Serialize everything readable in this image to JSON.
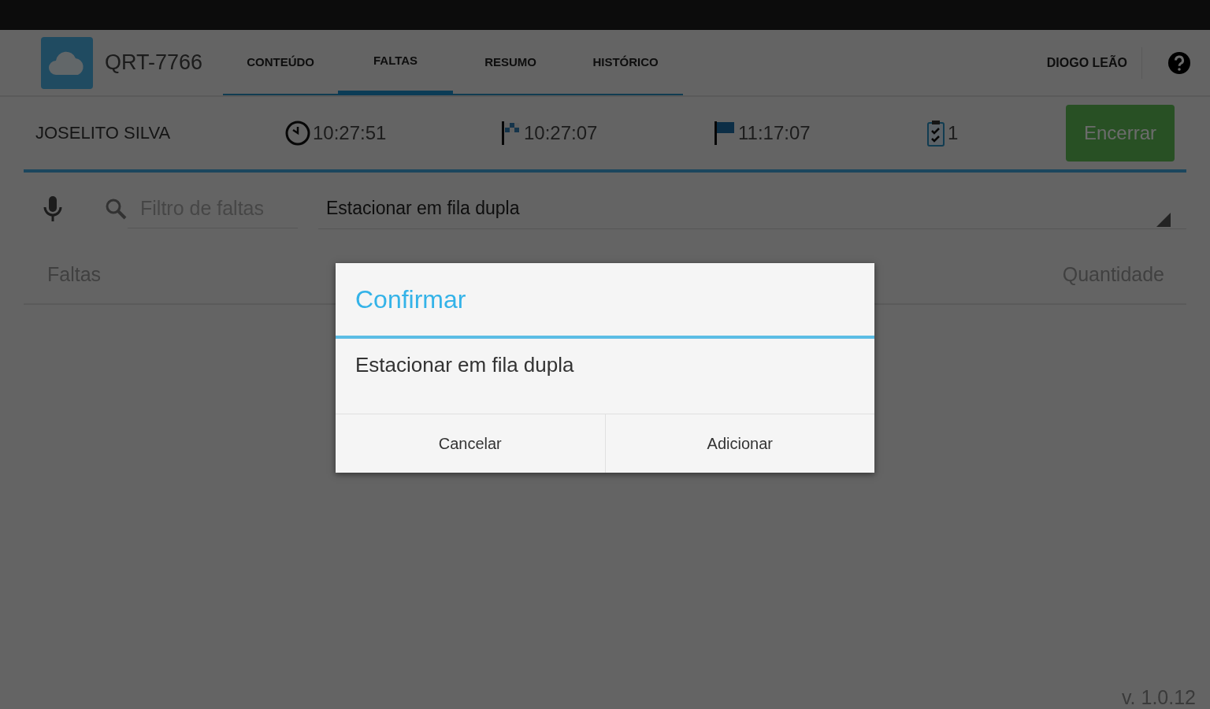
{
  "header": {
    "title": "QRT-7766",
    "user": "DIOGO LEÃO",
    "tabs": [
      {
        "label": "CONTEÚDO",
        "selected": false
      },
      {
        "label": "FALTAS",
        "selected": true
      },
      {
        "label": "RESUMO",
        "selected": false
      },
      {
        "label": "HISTÓRICO",
        "selected": false
      }
    ]
  },
  "info": {
    "name": "JOSELITO SILVA",
    "items": [
      {
        "kind": "clock",
        "text": "10:27:51"
      },
      {
        "kind": "start",
        "text": "10:27:07"
      },
      {
        "kind": "end",
        "text": "11:17:07"
      },
      {
        "kind": "count",
        "text": "1"
      }
    ],
    "button": "Encerrar"
  },
  "filter": {
    "placeholder": "Filtro de faltas",
    "selection": "Estacionar em fila dupla"
  },
  "table": {
    "columns": [
      "Faltas",
      "Quantidade"
    ]
  },
  "dialog": {
    "title": "Confirmar",
    "message": "Estacionar em fila dupla",
    "buttons": [
      "Cancelar",
      "Adicionar"
    ]
  },
  "version": "v. 1.0.12"
}
